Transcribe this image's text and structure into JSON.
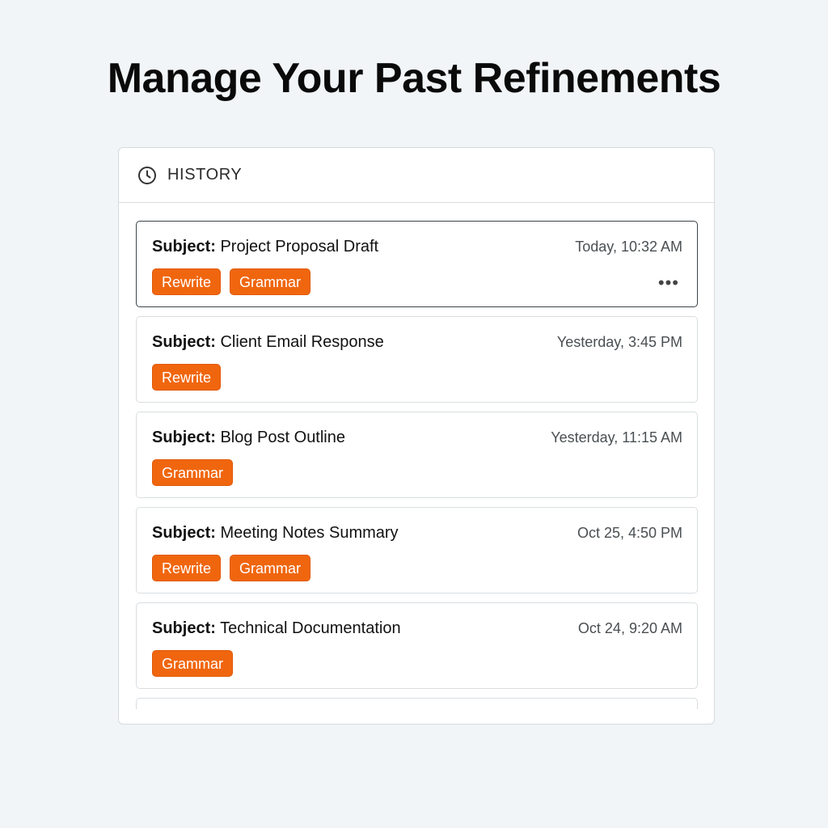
{
  "page": {
    "title": "Manage Your Past Refinements"
  },
  "history": {
    "header_label": "HISTORY",
    "header_icon": "clock-icon",
    "subject_key": "Subject:",
    "items": [
      {
        "subject": "Project Proposal Draft",
        "time": "Today, 10:32 AM",
        "tags": [
          "Rewrite",
          "Grammar"
        ],
        "selected": true,
        "menu": "•••"
      },
      {
        "subject": "Client Email Response",
        "time": "Yesterday, 3:45 PM",
        "tags": [
          "Rewrite"
        ]
      },
      {
        "subject": "Blog Post Outline",
        "time": "Yesterday, 11:15 AM",
        "tags": [
          "Grammar"
        ]
      },
      {
        "subject": "Meeting Notes Summary",
        "time": "Oct 25, 4:50 PM",
        "tags": [
          "Rewrite",
          "Grammar"
        ]
      },
      {
        "subject": "Technical Documentation",
        "time": "Oct 24, 9:20 AM",
        "tags": [
          "Grammar"
        ]
      }
    ]
  },
  "colors": {
    "accent": "#f0660e",
    "background": "#f1f5f7",
    "selected_border": "#3b4448"
  }
}
